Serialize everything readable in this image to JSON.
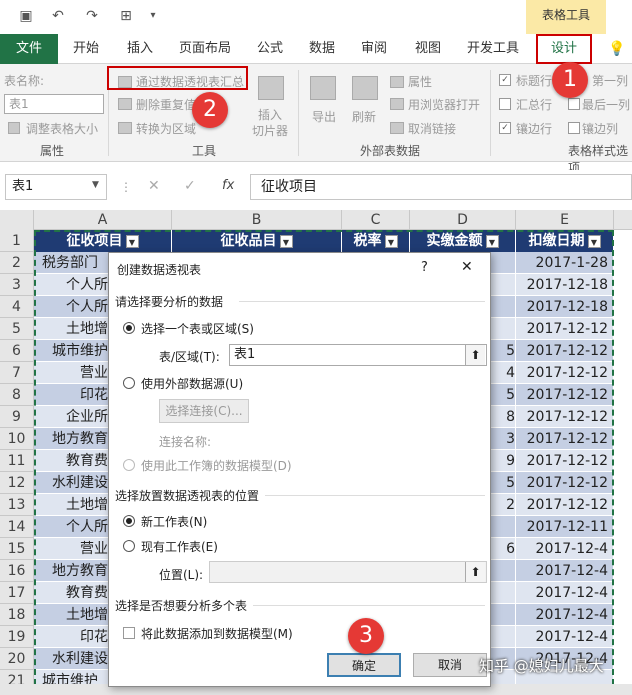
{
  "context_group": "表格工具",
  "tabs": [
    "文件",
    "开始",
    "插入",
    "页面布局",
    "公式",
    "数据",
    "审阅",
    "视图",
    "开发工具",
    "设计"
  ],
  "ribbon": {
    "table_name_label": "表名称:",
    "table_name_value": "表1",
    "resize_table": "调整表格大小",
    "group_properties": "属性",
    "summarize_pivot": "通过数据透视表汇总",
    "remove_duplicates": "删除重复值",
    "convert_range": "转换为区域",
    "insert_slicer": "插入\n切片器",
    "insert_slicer_l1": "插入",
    "insert_slicer_l2": "切片器",
    "group_tools": "工具",
    "export": "导出",
    "refresh": "刷新",
    "properties": "属性",
    "open_browser": "用浏览器打开",
    "unlink": "取消链接",
    "group_external": "外部表数据",
    "header_row": "标题行",
    "first_col": "第一列",
    "total_row": "汇总行",
    "last_col": "最后一列",
    "banded_rows": "镶边行",
    "banded_cols": "镶边列",
    "group_style": "表格样式选项"
  },
  "formula": {
    "name_box": "表1",
    "value": "征收项目"
  },
  "columns": [
    "A",
    "B",
    "C",
    "D",
    "E"
  ],
  "table_headers": [
    "征收项目",
    "征收品目",
    "税率",
    "实缴金额",
    "扣缴日期"
  ],
  "rows": [
    {
      "n": "1"
    },
    {
      "n": "2",
      "a": "税务部门",
      "d": "",
      "e": "2017-1-28"
    },
    {
      "n": "3",
      "a": "个人所",
      "d": "",
      "e": "2017-12-18"
    },
    {
      "n": "4",
      "a": "个人所",
      "d": "",
      "e": "2017-12-18"
    },
    {
      "n": "5",
      "a": "土地增",
      "d": "",
      "e": "2017-12-12"
    },
    {
      "n": "6",
      "a": "城市维护",
      "d": "5",
      "e": "2017-12-12"
    },
    {
      "n": "7",
      "a": "营业",
      "d": "4",
      "e": "2017-12-12"
    },
    {
      "n": "8",
      "a": "印花",
      "d": "5",
      "e": "2017-12-12"
    },
    {
      "n": "9",
      "a": "企业所",
      "d": "8",
      "e": "2017-12-12"
    },
    {
      "n": "10",
      "a": "地方教育",
      "d": "3",
      "e": "2017-12-12"
    },
    {
      "n": "11",
      "a": "教育费",
      "d": "9",
      "e": "2017-12-12"
    },
    {
      "n": "12",
      "a": "水利建设",
      "d": "5",
      "e": "2017-12-12"
    },
    {
      "n": "13",
      "a": "土地增",
      "d": "2",
      "e": "2017-12-12"
    },
    {
      "n": "14",
      "a": "个人所",
      "d": "",
      "e": "2017-12-11"
    },
    {
      "n": "15",
      "a": "营业",
      "d": "6",
      "e": "2017-12-4"
    },
    {
      "n": "16",
      "a": "地方教育",
      "d": "",
      "e": "2017-12-4"
    },
    {
      "n": "17",
      "a": "教育费",
      "d": "",
      "e": "2017-12-4"
    },
    {
      "n": "18",
      "a": "土地增",
      "d": "",
      "e": "2017-12-4"
    },
    {
      "n": "19",
      "a": "印花",
      "d": "",
      "e": "2017-12-4"
    },
    {
      "n": "20",
      "a": "水利建设",
      "d": "",
      "e": "2017-12-4"
    },
    {
      "n": "21",
      "a": "城市维护",
      "d": "",
      "e": ""
    }
  ],
  "dialog": {
    "title": "创建数据透视表",
    "help": "?",
    "close": "✕",
    "section1": "请选择要分析的数据",
    "opt_range": "选择一个表或区域(S)",
    "range_label": "表/区域(T):",
    "range_value": "表1",
    "opt_external": "使用外部数据源(U)",
    "choose_conn": "选择连接(C)...",
    "conn_name": "连接名称:",
    "opt_model": "使用此工作簿的数据模型(D)",
    "section2": "选择放置数据透视表的位置",
    "opt_new": "新工作表(N)",
    "opt_existing": "现有工作表(E)",
    "location_label": "位置(L):",
    "section3": "选择是否想要分析多个表",
    "add_model": "将此数据添加到数据模型(M)",
    "ok": "确定",
    "cancel": "取消"
  },
  "badges": [
    "1",
    "2",
    "3"
  ],
  "watermark": "知乎 @媳妇儿最大",
  "colors": {
    "excel_green": "#217346",
    "header_navy": "#1f3b73",
    "band": "#c5cfe3",
    "band_light": "#dfe5f0",
    "annotation_red": "#e53935"
  }
}
